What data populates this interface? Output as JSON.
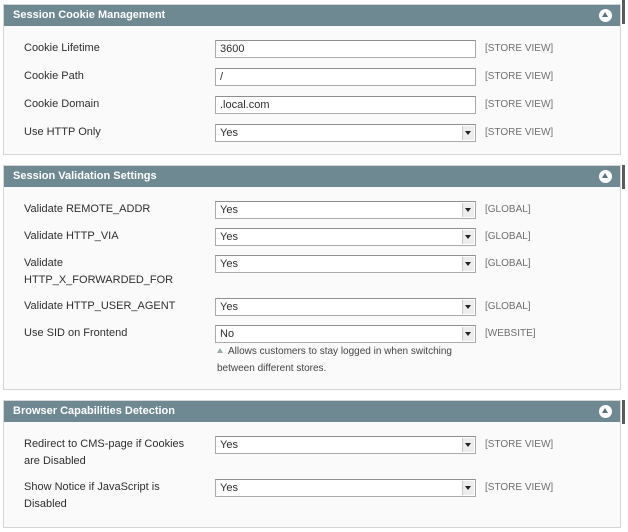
{
  "sections": [
    {
      "title": "Session Cookie Management",
      "rows": [
        {
          "label": "Cookie Lifetime",
          "value": "3600",
          "scope": "[STORE VIEW]"
        },
        {
          "label": "Cookie Path",
          "value": "/",
          "scope": "[STORE VIEW]"
        },
        {
          "label": "Cookie Domain",
          "value": ".local.com",
          "scope": "[STORE VIEW]"
        },
        {
          "label": "Use HTTP Only",
          "value": "Yes",
          "scope": "[STORE VIEW]"
        }
      ]
    },
    {
      "title": "Session Validation Settings",
      "rows": [
        {
          "label": "Validate REMOTE_ADDR",
          "value": "Yes",
          "scope": "[GLOBAL]"
        },
        {
          "label": "Validate HTTP_VIA",
          "value": "Yes",
          "scope": "[GLOBAL]"
        },
        {
          "label": "Validate HTTP_X_FORWARDED_FOR",
          "value": "Yes",
          "scope": "[GLOBAL]"
        },
        {
          "label": "Validate HTTP_USER_AGENT",
          "value": "Yes",
          "scope": "[GLOBAL]"
        },
        {
          "label": "Use SID on Frontend",
          "value": "No",
          "scope": "[WEBSITE]",
          "note": "Allows customers to stay logged in when switching between different stores."
        }
      ]
    },
    {
      "title": "Browser Capabilities Detection",
      "rows": [
        {
          "label": "Redirect to CMS-page if Cookies are Disabled",
          "value": "Yes",
          "scope": "[STORE VIEW]"
        },
        {
          "label": "Show Notice if JavaScript is Disabled",
          "value": "Yes",
          "scope": "[STORE VIEW]"
        }
      ]
    }
  ],
  "colors": {
    "header_bg": "#6f8992",
    "panel_bg": "#fafafa",
    "scope_text": "#6f6f6f"
  },
  "icons": {
    "collapse": "collapse-arrow-up-icon",
    "select": "dropdown-arrow-icon",
    "note": "note-triangle-icon"
  }
}
